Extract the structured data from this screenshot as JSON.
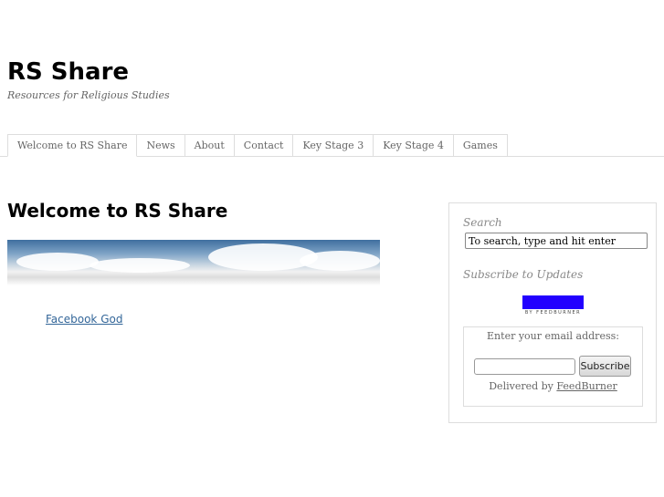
{
  "site": {
    "title": "RS Share",
    "tagline": "Resources for Religious Studies"
  },
  "nav": [
    {
      "label": "Welcome to RS Share"
    },
    {
      "label": "News"
    },
    {
      "label": "About"
    },
    {
      "label": "Contact"
    },
    {
      "label": "Key Stage 3"
    },
    {
      "label": "Key Stage 4"
    },
    {
      "label": "Games"
    }
  ],
  "main": {
    "heading": "Welcome to RS Share",
    "link": "Facebook God"
  },
  "sidebar": {
    "search_title": "Search",
    "search_value": "To search, type and hit enter",
    "subscribe_title": "Subscribe to Updates",
    "feedburner_badge": "BY FEEDBURNER",
    "badge_color": "#2200ff",
    "email_label": "Enter your email address:",
    "email_value": "",
    "subscribe_button": "Subscribe",
    "delivered_by": "Delivered by",
    "feedburner_link": "FeedBurner"
  }
}
